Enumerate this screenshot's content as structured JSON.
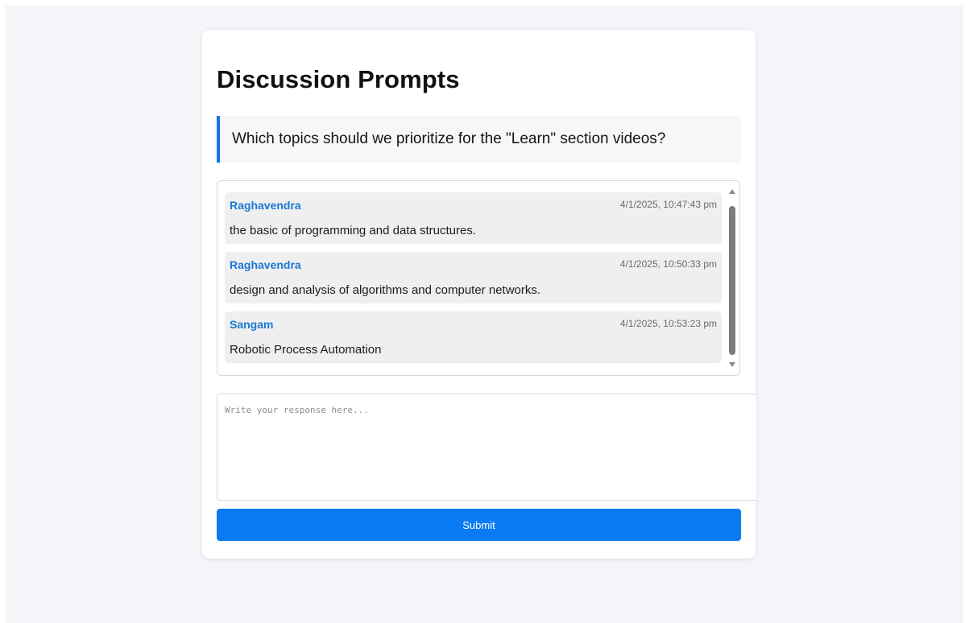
{
  "page_title": "Discussion Prompts",
  "prompt": {
    "question": "Which topics should we prioritize for the \"Learn\" section videos?",
    "accent_color": "#1376e2"
  },
  "responses": [
    {
      "author": "Raghavendra",
      "timestamp": "4/1/2025, 10:47:43 pm",
      "text": "the basic of programming and data structures."
    },
    {
      "author": "Raghavendra",
      "timestamp": "4/1/2025, 10:50:33 pm",
      "text": "design and analysis of algorithms and computer networks."
    },
    {
      "author": "Sangam",
      "timestamp": "4/1/2025, 10:53:23 pm",
      "text": "Robotic Process Automation"
    }
  ],
  "form": {
    "placeholder": "Write your response here...",
    "value": "",
    "submit_label": "Submit",
    "submit_color": "#0a7bf2"
  }
}
